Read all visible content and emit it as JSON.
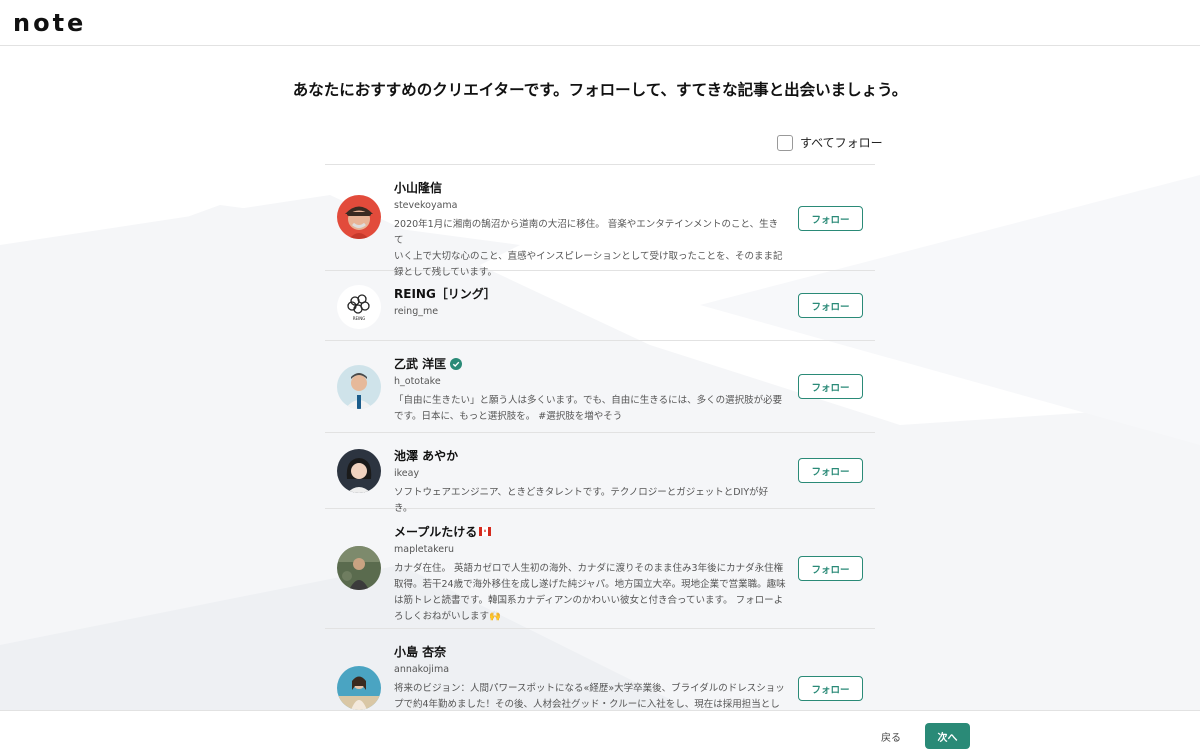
{
  "header": {
    "logo_text": "note"
  },
  "headline": "あなたにおすすめのクリエイターです。フォローして、すてきな記事と出会いましょう。",
  "follow_all": {
    "label": "すべてフォロー",
    "checked": false
  },
  "follow_button_label": "フォロー",
  "creators": [
    {
      "name": "小山隆信",
      "id": "stevekoyama",
      "bio": [
        "2020年1月に湘南の鵠沼から道南の大沼に移住。 音楽やエンタテインメントのこと、生きて",
        "いく上で大切な心のこと、直感やインスピレーションとして受け取ったことを、そのまま記",
        "録として残しています。"
      ],
      "avatar_icon": "avatar-man-hat",
      "avatar_color": "#e24b3b"
    },
    {
      "name": "REING［リング］",
      "id": "reing_me",
      "bio": [],
      "avatar_icon": "reing-logo",
      "avatar_text": "REING",
      "avatar_color": "#ffffff"
    },
    {
      "name": "乙武 洋匡",
      "id": "h_ototake",
      "verified": true,
      "bio": [
        "「自由に生きたい」と願う人は多くいます。でも、自由に生きるには、多くの選択肢が必要",
        "です。日本に、もっと選択肢を。 #選択肢を増やそう"
      ],
      "avatar_icon": "avatar-man-suit",
      "avatar_color": "#cfe3ea"
    },
    {
      "name": "池澤 あやか",
      "id": "ikeay",
      "bio": [
        "ソフトウェアエンジニア、ときどきタレントです。テクノロジーとガジェットとDIYが好き。"
      ],
      "avatar_icon": "avatar-woman",
      "avatar_color": "#2c3440"
    },
    {
      "name": "メープルたける",
      "id": "mapletakeru",
      "flag": "canada-flag-icon",
      "bio": [
        "カナダ在住。 英語カゼロで人生初の海外、カナダに渡りそのまま住み3年後にカナダ永住権",
        "取得。若干24歳で海外移住を成し遂げた純ジャパ。地方国立大卒。現地企業で営業職。趣味",
        "は筋トレと読書です。韓国系カナディアンのかわいい彼女と付き合っています。 フォローよ",
        "ろしくおねがいします🙌"
      ],
      "avatar_icon": "avatar-outdoor",
      "avatar_color": "#5a6b4e"
    },
    {
      "name": "小島 杏奈",
      "id": "annakojima",
      "bio": [
        "将来のビジョン：人間パワースポットになる«経歴»大学卒業後、ブライダルのドレスショッ",
        "プで約4年勤めました！その後、人材会社グッド・クルーに入社をし、現在は採用担当として"
      ],
      "avatar_icon": "avatar-woman-beach",
      "avatar_color": "#4aa4c2"
    }
  ],
  "footer": {
    "back_label": "戻る",
    "next_label": "次へ"
  },
  "colors": {
    "accent": "#2a8a77",
    "border": "#e2e2e2",
    "background_shape": "#f4f5f7"
  }
}
